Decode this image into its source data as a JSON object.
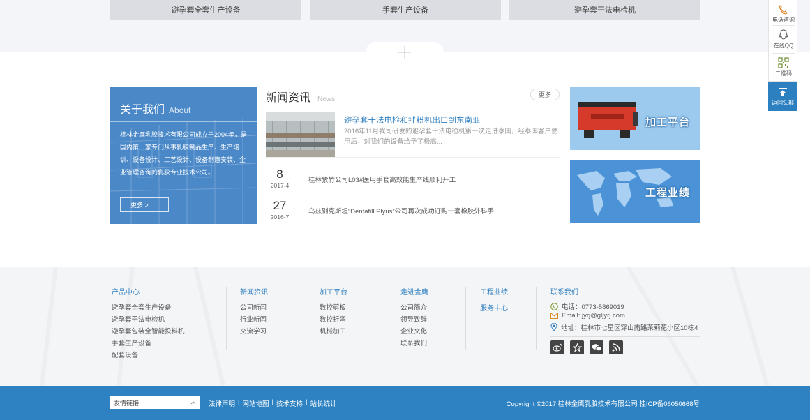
{
  "products_tabs": [
    "避孕套全套生产设备",
    "手套生产设备",
    "避孕套干法电检机"
  ],
  "about": {
    "title": "关于我们",
    "title_en": "About",
    "desc": "桂林金鹰乳胶技术有限公司成立于2004年，是国内第一家专门从事乳胶制品生产、生产培训、设备设计、工艺设计、设备制造安装、企业管理咨询的乳胶专业技术公司。",
    "more": "更多 >"
  },
  "news": {
    "title": "新闻资讯",
    "title_en": "News",
    "more": "更多",
    "featured": {
      "title": "避孕套干法电检和拌粉机出口到东南亚",
      "desc": "2016年11月我司研发的避孕套干法电检机第一次走进泰国，经泰国客户使用后，对我们的设备给予了极高..."
    },
    "items": [
      {
        "day": "8",
        "ym": "2017-4",
        "title": "桂林紫竹公司L03#医用手套高效能生产线顺利开工"
      },
      {
        "day": "27",
        "ym": "2016-7",
        "title": "乌兹别克斯坦“Dentafill Plyus”公司再次成功订购一套橡胶外科手..."
      }
    ]
  },
  "banners": [
    "加工平台",
    "工程业绩"
  ],
  "side": {
    "phone": "电话咨询",
    "qq": "在线QQ",
    "qr": "二维码",
    "top": "返回头部"
  },
  "footer": {
    "cols": [
      {
        "h": "产品中心",
        "links": [
          "避孕套全套生产设备",
          "避孕套干法电检机",
          "避孕套包装全智能投料机",
          "手套生产设备",
          "配套设备"
        ]
      },
      {
        "h": "新闻资讯",
        "links": [
          "公司新闻",
          "行业新闻",
          "交流学习"
        ]
      },
      {
        "h": "加工平台",
        "links": [
          "数控剪板",
          "数控折弯",
          "机械加工"
        ]
      },
      {
        "h": "走进金鹰",
        "links": [
          "公司简介",
          "领导致辞",
          "企业文化",
          "联系我们"
        ]
      },
      {
        "h": "工程业绩",
        "links": []
      },
      {
        "h": "服务中心",
        "links": []
      }
    ],
    "contact": {
      "h": "联系我们",
      "phone": "电话：0773-5869019",
      "email": "Email: jyrj@gljyrj.com",
      "address": "地址：桂林市七星区穿山南路茉莉花小区10栋4"
    }
  },
  "bottom": {
    "friend_links": "友情链接",
    "links": [
      "法律声明",
      "网站地图",
      "技术支持",
      "站长统计"
    ],
    "copyright": "Copyright ©2017 桂林金鹰乳胶技术有限公司 桂ICP备06050668号"
  },
  "colors": {
    "accent": "#2f7fc1",
    "bottom_bar": "#2e82c2",
    "about_bg": "#4a88c8"
  }
}
